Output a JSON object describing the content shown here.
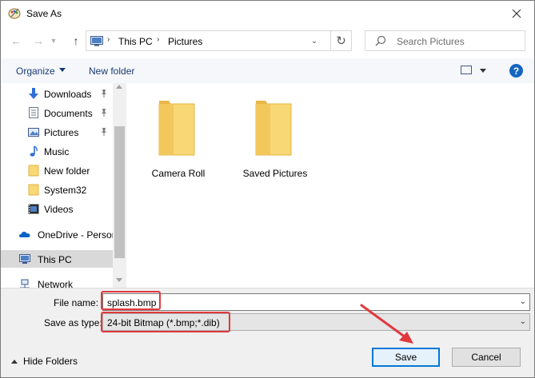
{
  "window": {
    "title": "Save As"
  },
  "address": {
    "crumbs": [
      "This PC",
      "Pictures"
    ]
  },
  "search": {
    "placeholder": "Search Pictures"
  },
  "toolbar": {
    "organize": "Organize",
    "new_folder": "New folder"
  },
  "sidebar": {
    "items": [
      {
        "label": "Downloads",
        "icon": "download-icon",
        "pinned": true
      },
      {
        "label": "Documents",
        "icon": "document-icon",
        "pinned": true
      },
      {
        "label": "Pictures",
        "icon": "pictures-icon",
        "pinned": true
      },
      {
        "label": "Music",
        "icon": "music-icon",
        "pinned": false
      },
      {
        "label": "New folder",
        "icon": "folder-icon",
        "pinned": false
      },
      {
        "label": "System32",
        "icon": "folder-icon",
        "pinned": false
      },
      {
        "label": "Videos",
        "icon": "video-icon",
        "pinned": false
      },
      {
        "label": "OneDrive - Persor",
        "icon": "cloud-icon",
        "pinned": false
      },
      {
        "label": "This PC",
        "icon": "computer-icon",
        "pinned": false,
        "selected": true
      },
      {
        "label": "Network",
        "icon": "network-icon",
        "pinned": false
      }
    ]
  },
  "folders": [
    {
      "label": "Camera Roll"
    },
    {
      "label": "Saved Pictures"
    }
  ],
  "form": {
    "file_name_label": "File name:",
    "file_name_value": "splash.bmp",
    "save_type_label": "Save as type:",
    "save_type_value": "24-bit Bitmap (*.bmp;*.dib)"
  },
  "footer": {
    "hide_folders": "Hide Folders",
    "save_label": "Save",
    "cancel_label": "Cancel"
  },
  "colors": {
    "accent": "#0078d7",
    "highlight": "#e0393e",
    "folder": "#f8d775"
  }
}
